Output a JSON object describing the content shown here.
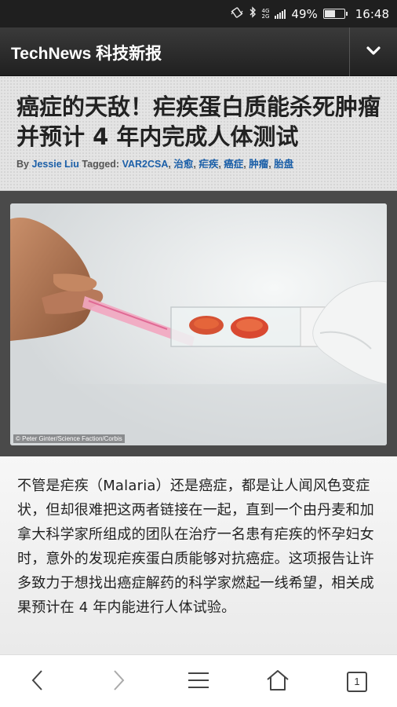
{
  "status_bar": {
    "network_top": "4G",
    "network_bottom": "2G",
    "battery_percent": "49%",
    "battery_level": 0.49,
    "time": "16:48",
    "icons": [
      "vibrate-icon",
      "bluetooth-icon",
      "signal-icon",
      "battery-icon"
    ]
  },
  "header": {
    "site_title": "TechNews 科技新报",
    "menu_icon": "chevron-down-icon"
  },
  "article": {
    "title": "癌症的天敌！疟疾蛋白质能杀死肿瘤并预计 4 年内完成人体测试",
    "byline_prefix": "By",
    "author": "Jessie Liu",
    "tagged_label": "Tagged:",
    "tags": [
      "VAR2CSA",
      "治愈",
      "疟疾",
      "癌症",
      "肿瘤",
      "胎盘"
    ],
    "image_credit": "© Peter Ginter/Science Faction/Corbis",
    "body": "不管是疟疾（Malaria）还是癌症，都是让人闻风色变症状，但却很难把这两者链接在一起，直到一个由丹麦和加拿大科学家所组成的团队在治疗一名患有疟疾的怀孕妇女时，意外的发现疟疾蛋白质能够对抗癌症。这项报告让许多致力于想找出癌症解药的科学家燃起一线希望，相关成果预计在 4 年内能进行人体试验。"
  },
  "browser_nav": {
    "back_icon": "back-icon",
    "forward_icon": "forward-icon",
    "menu_icon": "menu-icon",
    "home_icon": "home-icon",
    "tab_count": "1"
  },
  "colors": {
    "header_bg": "#2b2b2b",
    "link": "#1b5fa8",
    "title_text": "#222222"
  }
}
